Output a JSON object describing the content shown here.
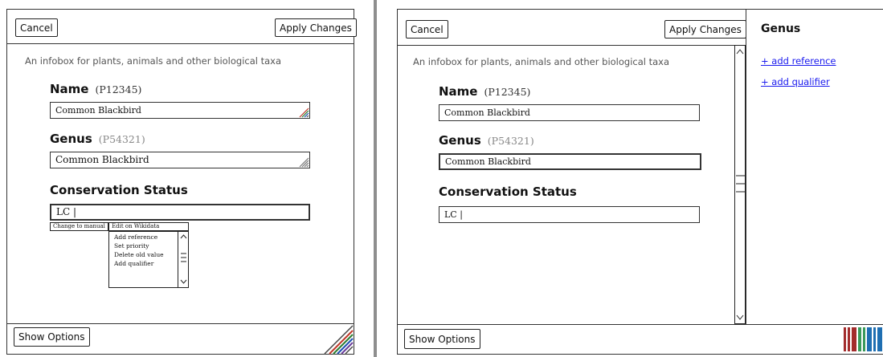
{
  "colors": {
    "link": "#1a1aee",
    "logo_red": "#a32c2c",
    "logo_green": "#3a9a5a",
    "logo_blue": "#1f6fb2"
  },
  "left": {
    "cancel_label": "Cancel",
    "apply_label": "Apply Changes",
    "description": "An infobox for plants, animals and other biological taxa",
    "name_label": "Name",
    "name_pid": "(P12345)",
    "name_value": "Common Blackbird",
    "genus_label": "Genus",
    "genus_pid": "(P54321)",
    "genus_value": "Common Blackbird",
    "status_label": "Conservation Status",
    "status_value": "LC |",
    "change_to_manual": "Change to manual",
    "edit_on_wikidata": "Edit on Wikidata",
    "menu_items": [
      "Add reference",
      "Set priority",
      "Delete old value",
      "Add qualifier"
    ],
    "show_options_label": "Show Options"
  },
  "right": {
    "cancel_label": "Cancel",
    "apply_label": "Apply Changes",
    "description": "An infobox for plants, animals and other biological taxa",
    "name_label": "Name",
    "name_pid": "(P12345)",
    "name_value": "Common Blackbird",
    "genus_label": "Genus",
    "genus_pid": "(P54321)",
    "genus_value": "Common Blackbird",
    "status_label": "Conservation Status",
    "status_value": "LC |",
    "show_options_label": "Show Options",
    "side_title": "Genus",
    "add_reference": "+ add reference",
    "add_qualifier": "+ add qualifier"
  }
}
